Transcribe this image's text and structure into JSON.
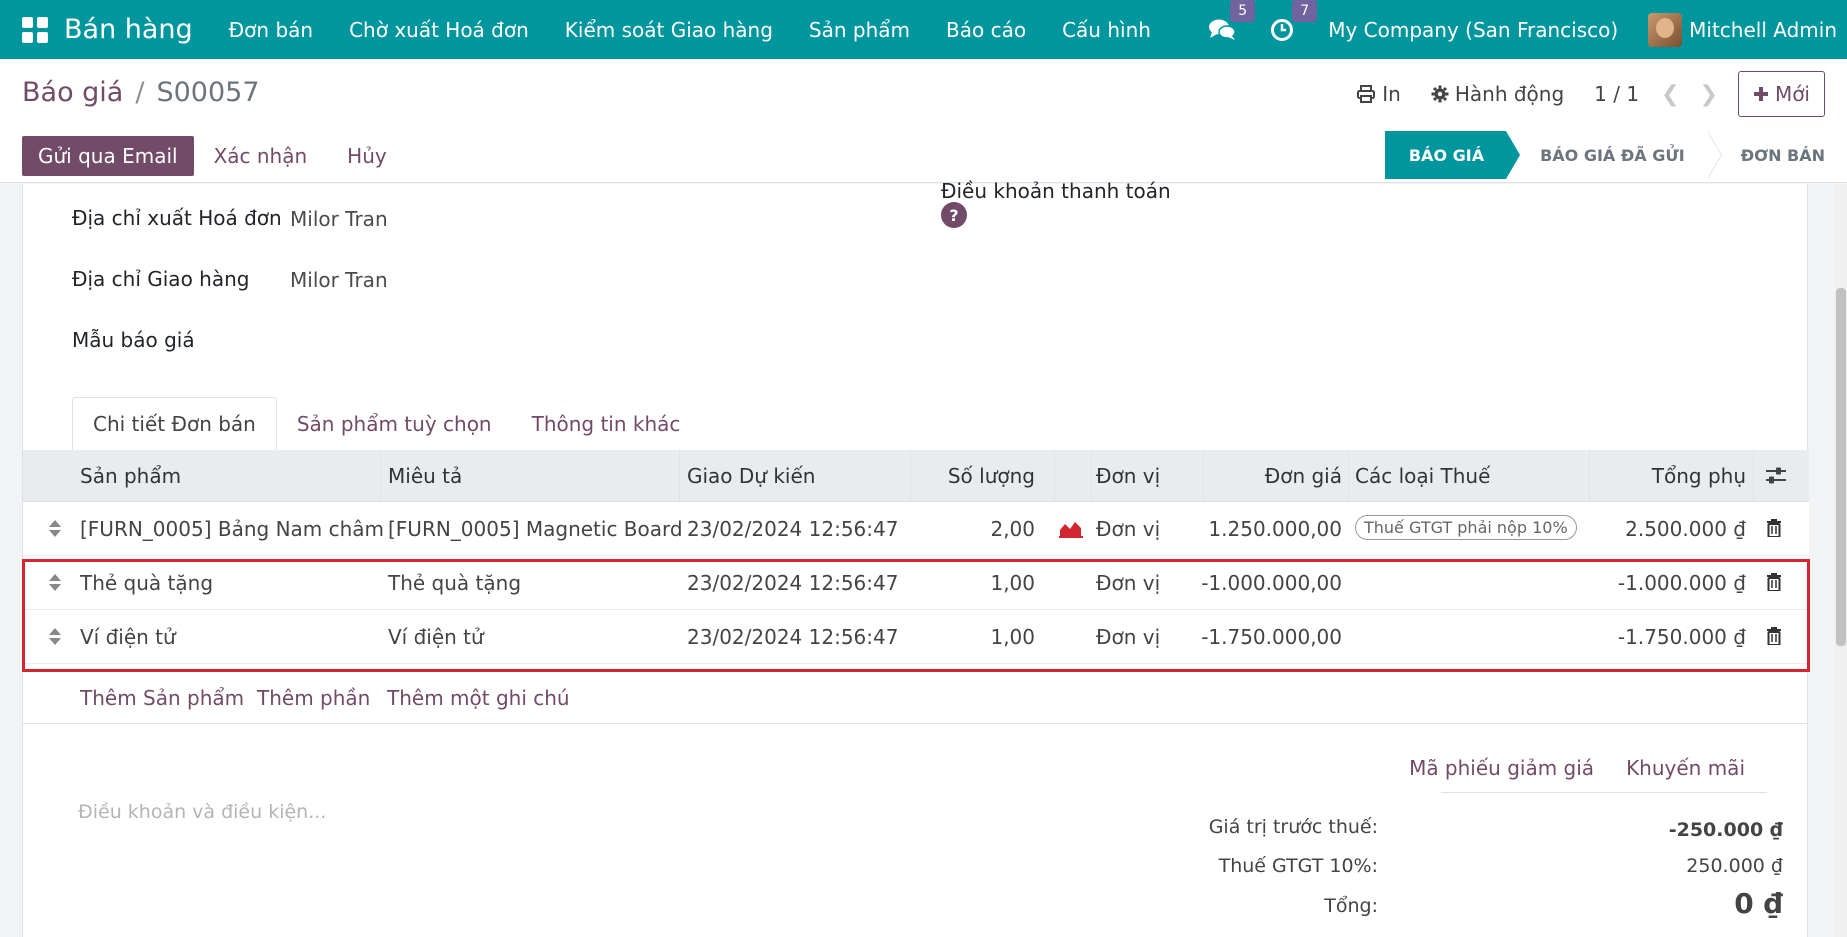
{
  "navbar": {
    "brand": "Bán hàng",
    "items": [
      "Đơn bán",
      "Chờ xuất Hoá đơn",
      "Kiểm soát Giao hàng",
      "Sản phẩm",
      "Báo cáo",
      "Cấu hình"
    ],
    "messages_count": "5",
    "activities_count": "7",
    "company": "My Company (San Francisco)",
    "user": "Mitchell Admin"
  },
  "control_panel": {
    "breadcrumb_parent": "Báo giá",
    "breadcrumb_sep": "/",
    "breadcrumb_current": "S00057",
    "print_label": "In",
    "action_label": "Hành động",
    "pager": "1 / 1",
    "new_label": "Mới",
    "buttons": {
      "send_email": "Gửi qua Email",
      "confirm": "Xác nhận",
      "cancel": "Hủy"
    },
    "statuses": [
      "BÁO GIÁ",
      "BÁO GIÁ ĐÃ GỬI",
      "ĐƠN BÁN"
    ]
  },
  "form": {
    "invoice_address_label": "Địa chỉ xuất Hoá đơn",
    "invoice_address_value": "Milor Tran",
    "delivery_address_label": "Địa chỉ Giao hàng",
    "delivery_address_value": "Milor Tran",
    "quote_template_label": "Mẫu báo giá",
    "payment_terms_label": "Điều khoản thanh toán",
    "help_glyph": "?"
  },
  "tabs": [
    "Chi tiết Đơn bán",
    "Sản phẩm tuỳ chọn",
    "Thông tin khác"
  ],
  "table": {
    "headers": {
      "product": "Sản phẩm",
      "description": "Miêu tả",
      "delivery_date": "Giao Dự kiến",
      "quantity": "Số lượng",
      "uom": "Đơn vị",
      "unit_price": "Đơn giá",
      "taxes": "Các loại Thuế",
      "subtotal": "Tổng phụ"
    },
    "rows": [
      {
        "product": "[FURN_0005] Bảng Nam châm",
        "description": "[FURN_0005] Magnetic Board",
        "delivery_date": "23/02/2024 12:56:47",
        "quantity": "2,00",
        "uom": "Đơn vị",
        "unit_price": "1.250.000,00",
        "tax": "Thuế GTGT phải nộp 10%",
        "subtotal": "2.500.000 ₫"
      },
      {
        "product": "Thẻ quà tặng",
        "description": "Thẻ quà tặng",
        "delivery_date": "23/02/2024 12:56:47",
        "quantity": "1,00",
        "uom": "Đơn vị",
        "unit_price": "-1.000.000,00",
        "tax": "",
        "subtotal": "-1.000.000 ₫"
      },
      {
        "product": "Ví điện tử",
        "description": "Ví điện tử",
        "delivery_date": "23/02/2024 12:56:47",
        "quantity": "1,00",
        "uom": "Đơn vị",
        "unit_price": "-1.750.000,00",
        "tax": "",
        "subtotal": "-1.750.000 ₫"
      }
    ],
    "add_product": "Thêm Sản phẩm",
    "add_section": "Thêm phần",
    "add_note": "Thêm một ghi chú"
  },
  "footer": {
    "terms_placeholder": "Điều khoản và điều kiện...",
    "coupon_label": "Mã phiếu giảm giá",
    "promotion_label": "Khuyến mãi",
    "untaxed_label": "Giá trị trước thuế:",
    "untaxed_value": "-250.000 ₫",
    "tax_label": "Thuế GTGT 10%:",
    "tax_value": "250.000 ₫",
    "total_label": "Tổng:",
    "total_value": "0 ₫"
  },
  "colors": {
    "navbar": "#00969e",
    "primary": "#714b67",
    "highlight": "#d22630"
  }
}
